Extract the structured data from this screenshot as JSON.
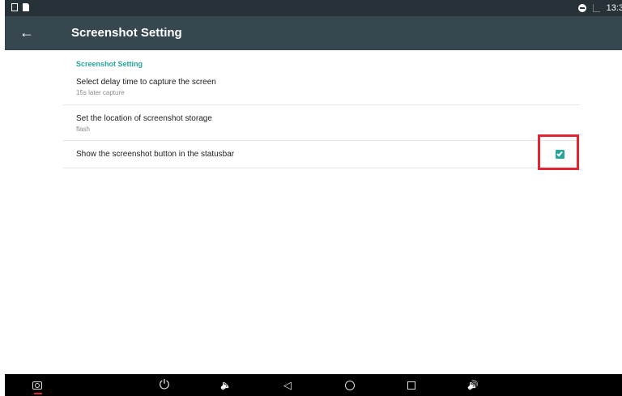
{
  "status_bar": {
    "time": "13:3",
    "left_icons": [
      "picture-icon",
      "sd-card-icon"
    ],
    "right_icons": [
      "do-not-disturb-icon",
      "signal-icon"
    ]
  },
  "app_bar": {
    "title": "Screenshot Setting",
    "back_icon": "arrow-back-icon",
    "back_glyph": "←"
  },
  "settings": {
    "section_header": "Screenshot Setting",
    "items": [
      {
        "title": "Select delay time to capture the screen",
        "summary": "15s later capture"
      },
      {
        "title": "Set the location of screenshot storage",
        "summary": "flash"
      },
      {
        "title": "Show the screenshot button in the statusbar",
        "checked": true
      }
    ]
  },
  "nav_bar": {
    "icons": [
      "screenshot-icon",
      "power-icon",
      "volume-down-icon",
      "back-triangle-icon",
      "home-circle-icon",
      "recents-square-icon",
      "volume-up-icon"
    ],
    "glyphs": {
      "power": "⏻",
      "volume_down": "🔈",
      "back": "◁",
      "volume_up": "🔊"
    }
  },
  "colors": {
    "status_bar": "#263238",
    "app_bar": "#37474f",
    "accent": "#26a69a",
    "highlight": "#e0272f"
  }
}
